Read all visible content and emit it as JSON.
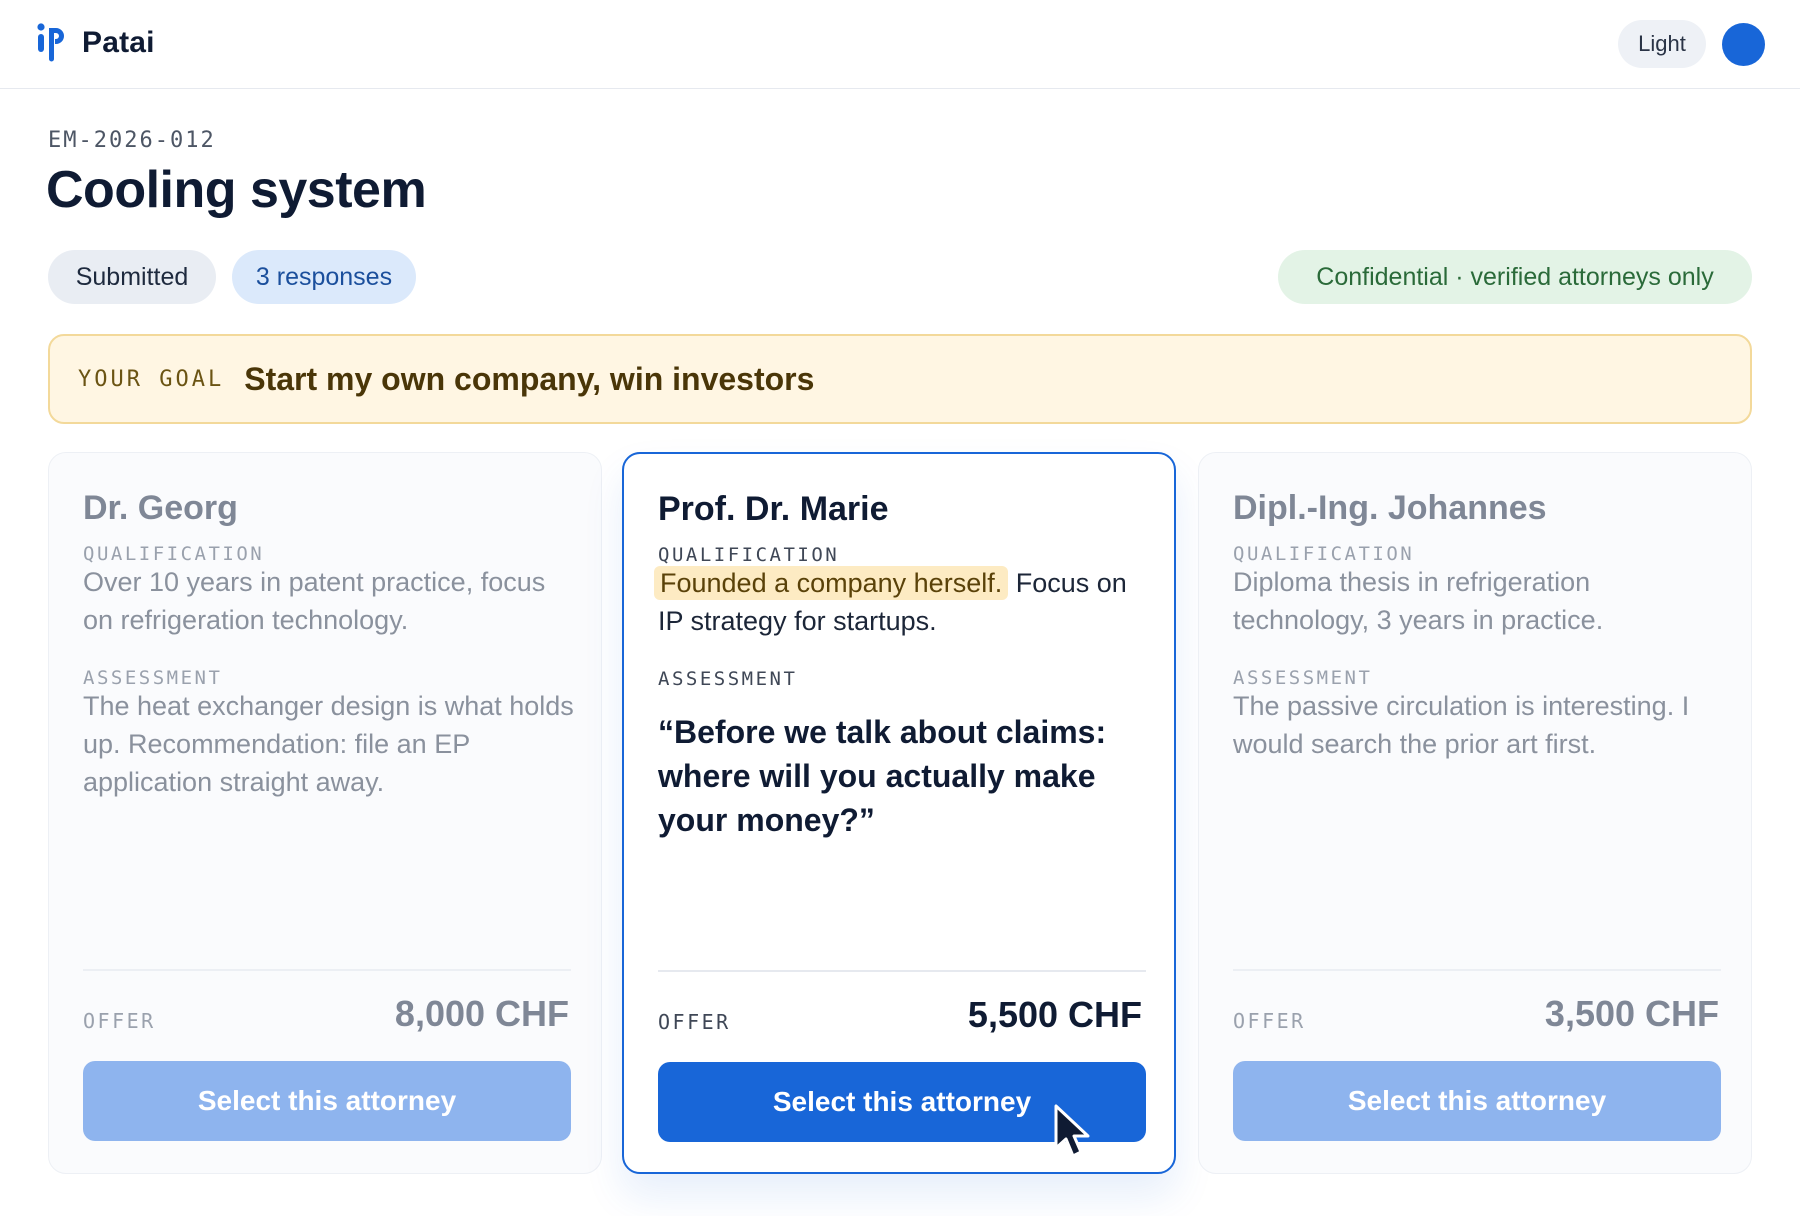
{
  "app": {
    "brand": "Patai",
    "logo_icon": "patai-logo-icon",
    "theme_toggle_label": "Light",
    "accent_color": "#1866d8"
  },
  "case": {
    "id": "EM-2026-012",
    "title": "Cooling system",
    "status": "Submitted",
    "responses": "3 responses",
    "confidentiality": "Confidential · verified attorneys only"
  },
  "goal": {
    "label": "YOUR GOAL",
    "text": "Start my own company, win investors"
  },
  "cards": [
    {
      "name": "Dr. Georg",
      "qualification_label": "QUALIFICATION",
      "qualification": "Over 10 years in patent practice, focus on refrigeration technology.",
      "assessment_label": "ASSESSMENT",
      "assessment": "The heat exchanger design is what holds up. Recommendation: file an EP application straight away.",
      "offer_label": "OFFER",
      "offer": "8,000 CHF",
      "button": "Select this attorney"
    },
    {
      "name": "Prof. Dr. Marie",
      "qualification_label": "QUALIFICATION",
      "qualification_highlight": "Founded a company herself.",
      "qualification_rest": "Focus on IP strategy for startups.",
      "assessment_label": "ASSESSMENT",
      "assessment": "“Before we talk about claims: where will you actually make your money?”",
      "offer_label": "OFFER",
      "offer": "5,500 CHF",
      "button": "Select this attorney"
    },
    {
      "name": "Dipl.-Ing. Johannes",
      "qualification_label": "QUALIFICATION",
      "qualification": "Diploma thesis in refrigeration technology, 3 years in practice.",
      "assessment_label": "ASSESSMENT",
      "assessment": "The passive circulation is interesting. I would search the prior art first.",
      "offer_label": "OFFER",
      "offer": "3,500 CHF",
      "button": "Select this attorney"
    }
  ]
}
